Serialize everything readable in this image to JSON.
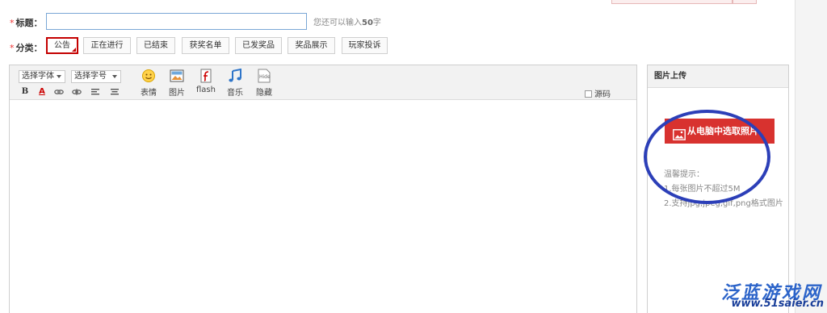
{
  "form": {
    "title_label": "标题：",
    "title_required": "*",
    "title_value": "",
    "title_hint_prefix": "您还可以输入",
    "title_hint_count": "50",
    "title_hint_suffix": "字",
    "category_label": "分类：",
    "category_required": "*",
    "categories": [
      {
        "label": "公告",
        "selected": true
      },
      {
        "label": "正在进行"
      },
      {
        "label": "已结束"
      },
      {
        "label": "获奖名单"
      },
      {
        "label": "已发奖品"
      },
      {
        "label": "奖品展示"
      },
      {
        "label": "玩家投诉"
      }
    ]
  },
  "editor": {
    "font_select": "选择字体",
    "size_select": "选择字号",
    "format_buttons": [
      "B",
      "A",
      "link-icon",
      "unlink-icon",
      "align-left-icon",
      "align-center-icon"
    ],
    "tools": [
      {
        "label": "表情",
        "icon": "emoticon-icon"
      },
      {
        "label": "图片",
        "icon": "image-icon"
      },
      {
        "label": "flash",
        "icon": "flash-icon"
      },
      {
        "label": "音乐",
        "icon": "music-icon"
      },
      {
        "label": "隐藏",
        "icon": "hide-icon"
      }
    ],
    "source_label": "源码"
  },
  "upload": {
    "title": "图片上传",
    "button_label": "从电脑中选取照片",
    "tips_title": "温馨提示：",
    "tip1": "1.每张图片不超过5M",
    "tip2": "2.支持jpg,jpeg,gif,png格式图片"
  },
  "watermark": {
    "brand": "泛蓝游戏网",
    "url": "www.51saier.cn"
  },
  "colors": {
    "accent_red": "#d8322f",
    "selected_border": "#c40000",
    "annotation_circle": "#2c3fb8"
  }
}
